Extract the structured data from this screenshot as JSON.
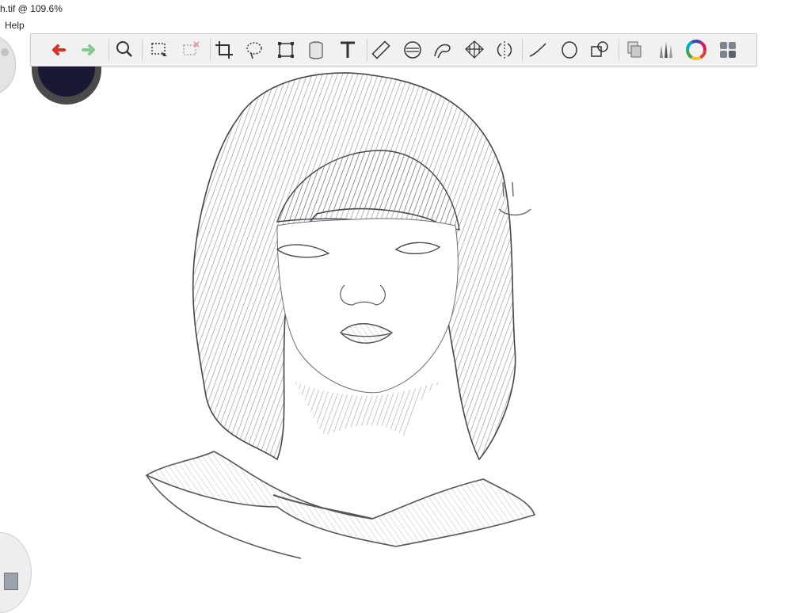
{
  "window": {
    "title": "h.tif @ 109.6%"
  },
  "menu": {
    "items": [
      "Help"
    ]
  },
  "toolbar": {
    "tools": [
      {
        "name": "undo-icon",
        "color": "#d9302a"
      },
      {
        "name": "redo-icon",
        "color": "#86c98e"
      },
      {
        "name": "magnifier-icon"
      },
      {
        "name": "selection-icon"
      },
      {
        "name": "clear-selection-icon"
      },
      {
        "name": "crop-icon"
      },
      {
        "name": "lasso-icon"
      },
      {
        "name": "transform-icon"
      },
      {
        "name": "fill-bucket-icon"
      },
      {
        "name": "text-icon"
      },
      {
        "name": "ruler-icon"
      },
      {
        "name": "ellipse-guide-icon"
      },
      {
        "name": "french-curve-icon"
      },
      {
        "name": "perspective-grid-icon"
      },
      {
        "name": "symmetry-icon"
      },
      {
        "name": "stroke-line-icon"
      },
      {
        "name": "ellipse-tool-icon"
      },
      {
        "name": "shapes-icon"
      },
      {
        "name": "layers-icon"
      },
      {
        "name": "brushes-icon"
      },
      {
        "name": "color-wheel-icon"
      },
      {
        "name": "ui-grid-icon"
      }
    ]
  },
  "palette": {
    "current_color": "#191835"
  }
}
